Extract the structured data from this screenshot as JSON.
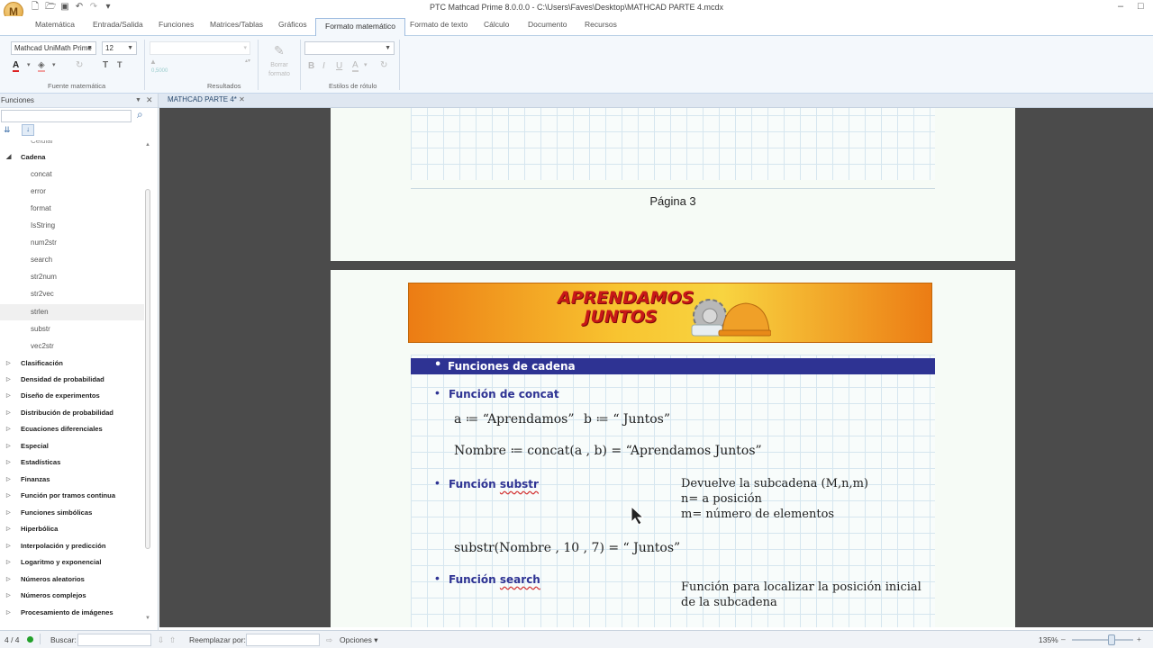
{
  "app": {
    "title": "PTC Mathcad Prime 8.0.0.0 - C:\\Users\\Faves\\Desktop\\MATHCAD PARTE 4.mcdx",
    "logo_letter": "M"
  },
  "ribbon_tabs": [
    "Matemática",
    "Entrada/Salida",
    "Funciones",
    "Matrices/Tablas",
    "Gráficos",
    "Formato matemático",
    "Formato de texto",
    "Cálculo",
    "Documento",
    "Recursos"
  ],
  "ribbon": {
    "font_name": "Mathcad UniMath Prime",
    "font_size": "12",
    "results_value": "0,5000",
    "clear_format_label": "Borrar formato",
    "group_font": "Fuente matemática",
    "group_results": "Resultados",
    "group_styles": "Estilos de rótulo",
    "style_value": ""
  },
  "left_panel": {
    "title": "Funciones",
    "search_value": "",
    "partial_item": "Celular",
    "expanded_category": "Cadena",
    "functions": [
      "concat",
      "error",
      "format",
      "IsString",
      "num2str",
      "search",
      "str2num",
      "str2vec",
      "strlen",
      "substr",
      "vec2str"
    ],
    "selected_function": "strlen",
    "categories": [
      "Clasificación",
      "Densidad de probabilidad",
      "Diseño de experimentos",
      "Distribución de probabilidad",
      "Ecuaciones diferenciales",
      "Especial",
      "Estadísticas",
      "Finanzas",
      "Función por tramos continua",
      "Funciones simbólicas",
      "Hiperbólica",
      "Interpolación y predicción",
      "Logaritmo y exponencial",
      "Números aleatorios",
      "Números complejos",
      "Procesamiento de imágenes"
    ]
  },
  "document": {
    "tab_label": "MATHCAD PARTE 4*",
    "page_label": "Página 3",
    "banner_text": "APRENDAMOS JUNTOS",
    "header_bar": "Funciones de cadena",
    "concat": {
      "title": "Función de concat",
      "line1_a": "a ≔ “Aprendamos”",
      "line1_b": "b ≔ “ Juntos”",
      "line2": "Nombre ≔ concat(a , b) = “Aprendamos Juntos”"
    },
    "substr": {
      "title_prefix": "Función ",
      "title_word": "substr",
      "note1": "Devuelve la subcadena (M,n,m)",
      "note2": "n= a posición",
      "note3": "m= número de elementos",
      "expr": "substr(Nombre , 10 , 7) = “ Juntos”"
    },
    "search": {
      "title_prefix": "Función ",
      "title_word": "search",
      "note": "Función para localizar la posición inicial de la subcadena"
    }
  },
  "status": {
    "page": "4 / 4",
    "find_label": "Buscar:",
    "find_value": "",
    "replace_label": "Reemplazar por:",
    "replace_value": "",
    "options_label": "Opciones",
    "zoom": "135%"
  },
  "colors": {
    "accent_blue": "#2e3393",
    "banner_orange": "#ec7c14",
    "workspace_gray": "#4b4b4b"
  }
}
